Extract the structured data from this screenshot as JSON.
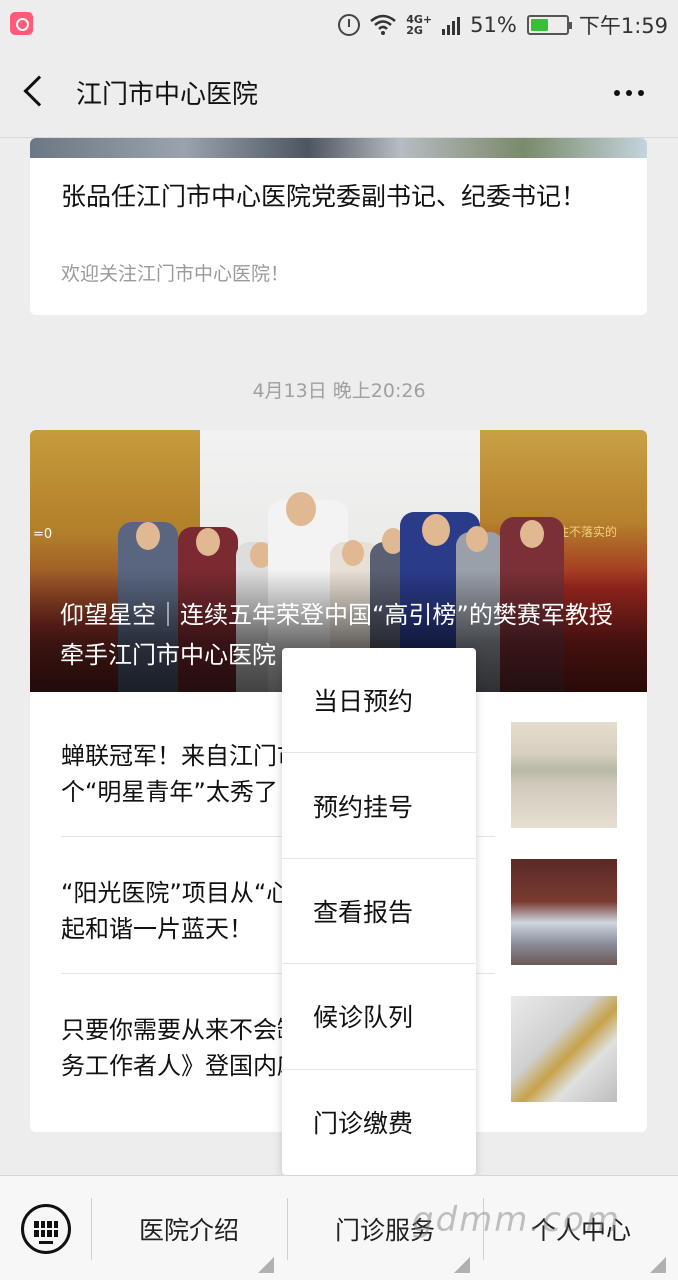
{
  "status_bar": {
    "network_label_top": "4G+",
    "network_label_bottom": "2G",
    "battery_percent": "51%",
    "battery_level": 0.51,
    "time": "下午1:59",
    "icons": [
      "app-badge-icon",
      "alarm-icon",
      "wifi-icon",
      "signal-icon",
      "battery-icon"
    ]
  },
  "nav": {
    "title": "江门市中心医院"
  },
  "article1": {
    "title": "张品任江门市中心医院党委副书记、纪委书记！",
    "subtitle": "欢迎关注江门市中心医院！"
  },
  "timestamp": "4月13日 晚上20:26",
  "article2": {
    "hero_title": "仰望星空｜连续五年荣登中国“高引榜”的樊赛军教授牵手江门市中心医院",
    "hero_sign_text": "抓住不落实的",
    "hero_left_text": "=0",
    "items": [
      {
        "title": "蝉联冠军！来自江门市中心医院的这个“明星青年”太秀了！"
      },
      {
        "title": "“阳光医院”项目从“心”出发，为患者撑起和谐一片蓝天！"
      },
      {
        "title": "只要你需要从来不会缺席——《最美医务工作者人》登国内麻醉领域"
      }
    ]
  },
  "popup_menu": {
    "items": [
      "当日预约",
      "预约挂号",
      "查看报告",
      "候诊队列",
      "门诊缴费"
    ]
  },
  "bottom_menu": {
    "tabs": [
      "医院介绍",
      "门诊服务",
      "个人中心"
    ],
    "watermark": "gdmm.com"
  },
  "colors": {
    "background": "#ededed",
    "card": "#ffffff",
    "battery_fill": "#35c135",
    "app_badge": "#ff5a78"
  }
}
